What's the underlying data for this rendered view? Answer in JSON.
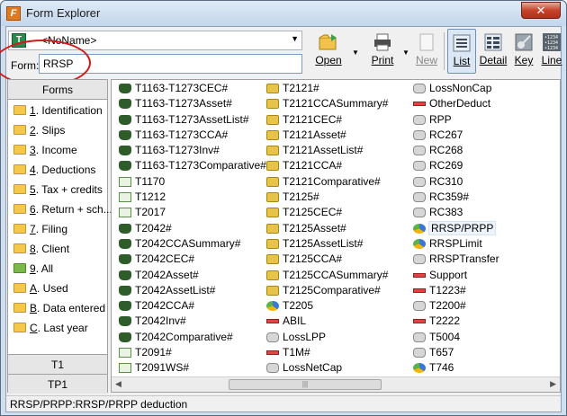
{
  "window": {
    "title": "Form Explorer",
    "close": "✕",
    "app_icon_letter": "F"
  },
  "client_combo": {
    "value": "<NoName>",
    "icon_letter": "T"
  },
  "form_field": {
    "label": "Form:",
    "value": "RRSP"
  },
  "toolbar": {
    "open": "Open",
    "print": "Print",
    "new": "New",
    "list": "List",
    "detail": "Detail",
    "key": "Key",
    "line": "Line",
    "line_icon_text": "•1234\n•1234\n•1234"
  },
  "left_pane": {
    "header": "Forms",
    "categories": [
      {
        "key": "1",
        "label": ". Identification"
      },
      {
        "key": "2",
        "label": ". Slips"
      },
      {
        "key": "3",
        "label": ". Income"
      },
      {
        "key": "4",
        "label": ". Deductions"
      },
      {
        "key": "5",
        "label": ". Tax + credits"
      },
      {
        "key": "6",
        "label": ". Return + sch..."
      },
      {
        "key": "7",
        "label": ". Filing"
      },
      {
        "key": "8",
        "label": ". Client"
      },
      {
        "key": "9",
        "label": ". All"
      },
      {
        "key": "A",
        "label": ". Used"
      },
      {
        "key": "B",
        "label": ". Data entered"
      },
      {
        "key": "C",
        "label": ". Last year"
      }
    ],
    "tab_t1": "T1",
    "tab_tp1": "TP1"
  },
  "forms_list": {
    "column1": [
      {
        "icon": "car-icon",
        "label": "T1163-T1273CEC#"
      },
      {
        "icon": "car-icon",
        "label": "T1163-T1273Asset#"
      },
      {
        "icon": "car-icon",
        "label": "T1163-T1273AssetList#"
      },
      {
        "icon": "car-icon",
        "label": "T1163-T1273CCA#"
      },
      {
        "icon": "car-icon",
        "label": "T1163-T1273Inv#"
      },
      {
        "icon": "car-icon",
        "label": "T1163-T1273Comparative#"
      },
      {
        "icon": "chart-icon",
        "label": "T1170"
      },
      {
        "icon": "chart-icon",
        "label": "T1212"
      },
      {
        "icon": "chart-icon",
        "label": "T2017"
      },
      {
        "icon": "car-icon",
        "label": "T2042#"
      },
      {
        "icon": "car-icon",
        "label": "T2042CCASummary#"
      },
      {
        "icon": "car-icon",
        "label": "T2042CEC#"
      },
      {
        "icon": "car-icon",
        "label": "T2042Asset#"
      },
      {
        "icon": "car-icon",
        "label": "T2042AssetList#"
      },
      {
        "icon": "car-icon",
        "label": "T2042CCA#"
      },
      {
        "icon": "car-icon",
        "label": "T2042Inv#"
      },
      {
        "icon": "car-icon",
        "label": "T2042Comparative#"
      },
      {
        "icon": "chart-icon",
        "label": "T2091#"
      },
      {
        "icon": "chart-icon",
        "label": "T2091WS#"
      }
    ],
    "column2": [
      {
        "icon": "tool-icon",
        "label": "T2121#"
      },
      {
        "icon": "tool-icon",
        "label": "T2121CCASummary#"
      },
      {
        "icon": "tool-icon",
        "label": "T2121CEC#"
      },
      {
        "icon": "tool-icon",
        "label": "T2121Asset#"
      },
      {
        "icon": "tool-icon",
        "label": "T2121AssetList#"
      },
      {
        "icon": "tool-icon",
        "label": "T2121CCA#"
      },
      {
        "icon": "tool-icon",
        "label": "T2121Comparative#"
      },
      {
        "icon": "tool-icon",
        "label": "T2125#"
      },
      {
        "icon": "tool-icon",
        "label": "T2125CEC#"
      },
      {
        "icon": "tool-icon",
        "label": "T2125Asset#"
      },
      {
        "icon": "tool-icon",
        "label": "T2125AssetList#"
      },
      {
        "icon": "tool-icon",
        "label": "T2125CCA#"
      },
      {
        "icon": "tool-icon",
        "label": "T2125CCASummary#"
      },
      {
        "icon": "tool-icon",
        "label": "T2125Comparative#"
      },
      {
        "icon": "pie-icon",
        "label": "T2205"
      },
      {
        "icon": "cancel-icon",
        "label": "ABIL"
      },
      {
        "icon": "drum-icon",
        "label": "LossLPP"
      },
      {
        "icon": "cancel-icon",
        "label": "T1M#"
      },
      {
        "icon": "drum-icon",
        "label": "LossNetCap"
      }
    ],
    "column3": [
      {
        "icon": "drum-icon",
        "label": "LossNonCap"
      },
      {
        "icon": "cancel-icon",
        "label": "OtherDeduct"
      },
      {
        "icon": "drum-icon",
        "label": "RPP"
      },
      {
        "icon": "drum-icon",
        "label": "RC267"
      },
      {
        "icon": "drum-icon",
        "label": "RC268"
      },
      {
        "icon": "drum-icon",
        "label": "RC269"
      },
      {
        "icon": "drum-icon",
        "label": "RC310"
      },
      {
        "icon": "drum-icon",
        "label": "RC359#"
      },
      {
        "icon": "drum-icon",
        "label": "RC383"
      },
      {
        "icon": "pie-icon",
        "label": "RRSP/PRPP",
        "selected": true
      },
      {
        "icon": "pie-icon",
        "label": "RRSPLimit"
      },
      {
        "icon": "drum-icon",
        "label": "RRSPTransfer"
      },
      {
        "icon": "cancel-icon",
        "label": "Support"
      },
      {
        "icon": "cancel-icon",
        "label": "T1223#"
      },
      {
        "icon": "drum-icon",
        "label": "T2200#"
      },
      {
        "icon": "cancel-icon",
        "label": "T2222"
      },
      {
        "icon": "drum-icon",
        "label": "T5004"
      },
      {
        "icon": "drum-icon",
        "label": "T657"
      },
      {
        "icon": "pie-icon",
        "label": "T746"
      }
    ]
  },
  "scrollbar": {
    "left_arrow": "◀",
    "right_arrow": "▶",
    "thumb_grip": "|||"
  },
  "status_bar": {
    "text": "RRSP/PRPP:RRSP/PRPP deduction"
  }
}
